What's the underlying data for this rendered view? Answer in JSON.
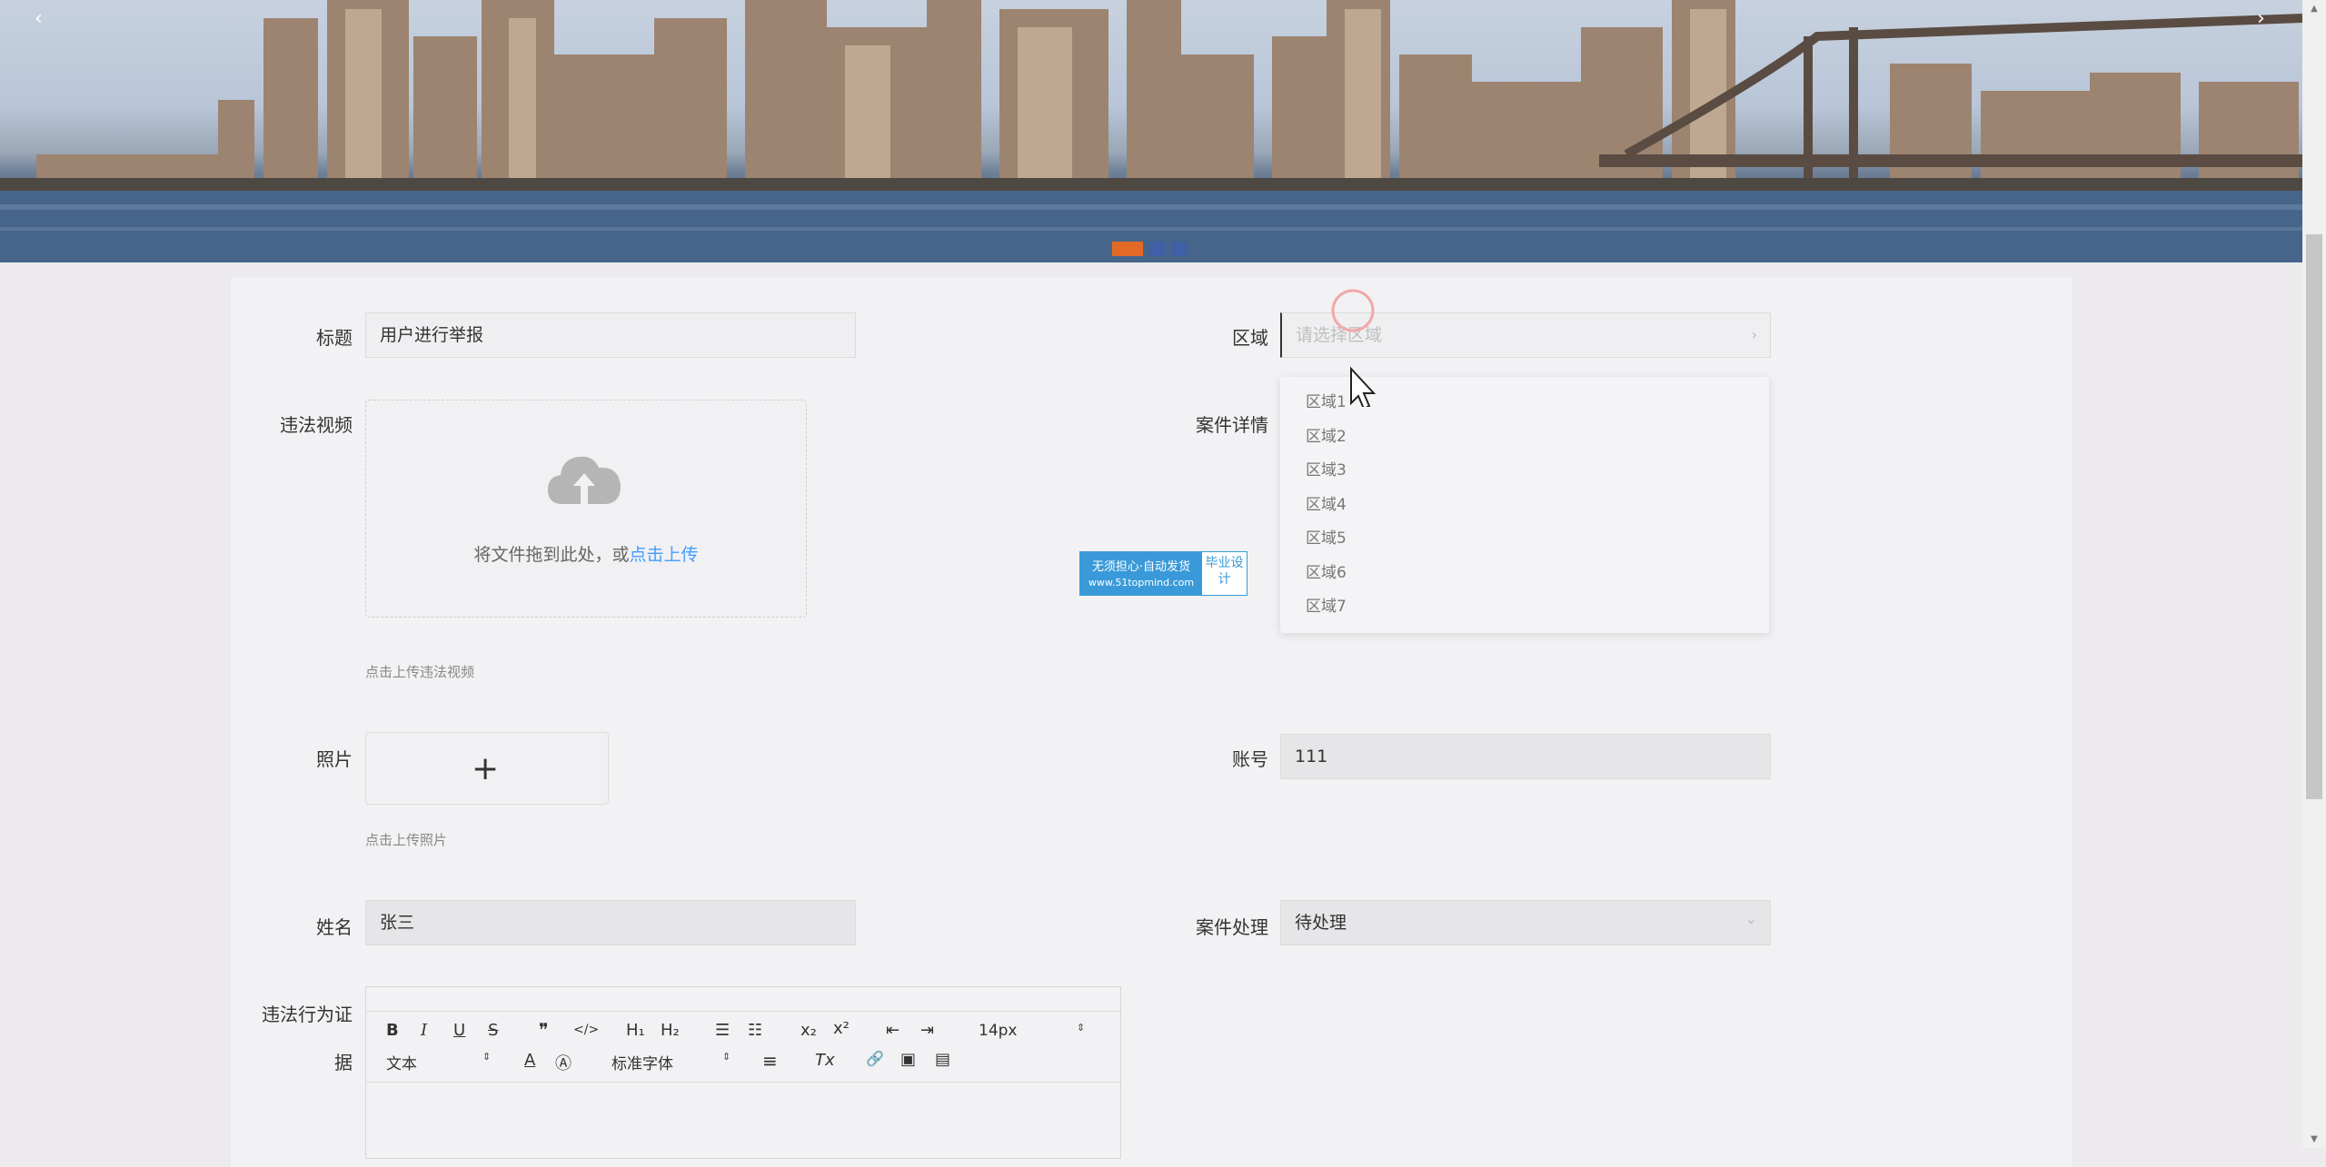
{
  "banner": {
    "prev_arrow": "‹",
    "next_arrow": "›",
    "slides": [
      1,
      2,
      3
    ],
    "active_slide": 1
  },
  "form": {
    "title_label": "标题",
    "title_value": "用户进行举报",
    "region_label": "区域",
    "region_placeholder": "请选择区域",
    "region_chevron": "›",
    "video_label": "违法视频",
    "upload_text": "将文件拖到此处，或",
    "upload_link": "点击上传",
    "video_hint": "点击上传违法视频",
    "case_detail_label": "案件详情",
    "photo_label": "照片",
    "photo_plus": "+",
    "photo_hint": "点击上传照片",
    "account_label": "账号",
    "account_value": "111",
    "name_label": "姓名",
    "name_value": "张三",
    "case_handle_label": "案件处理",
    "case_handle_value": "待处理",
    "case_handle_chevron": "⌄",
    "evidence_label_line1": "违法行为证",
    "evidence_label_line2": "据"
  },
  "region_options": [
    "区域1",
    "区域2",
    "区域3",
    "区域4",
    "区域5",
    "区域6",
    "区域7"
  ],
  "watermark": {
    "line1": "无须担心·自动发货",
    "line2": "www.51topmind.com",
    "right": "毕业设计"
  },
  "editor": {
    "bold": "B",
    "italic": "I",
    "underline": "U",
    "strike": "S",
    "quote": "❞",
    "code": "</>",
    "h1": "H₁",
    "h2": "H₂",
    "ol": "☰",
    "ul": "☷",
    "sub": "x₂",
    "sup": "x²",
    "outdent": "⇤",
    "indent": "⇥",
    "size": "14px",
    "header_select": "文本",
    "font_color": "A",
    "bg_color": "Ⓐ",
    "font_select": "标准字体",
    "align": "≡",
    "clean": "Tx",
    "link": "🔗",
    "image": "▣",
    "video": "▤"
  },
  "scrollbar": {
    "up": "▲",
    "down": "▼"
  },
  "colors": {
    "accent": "#409eff",
    "slide_active": "#e26a25",
    "slide": "#3f5fa6"
  }
}
